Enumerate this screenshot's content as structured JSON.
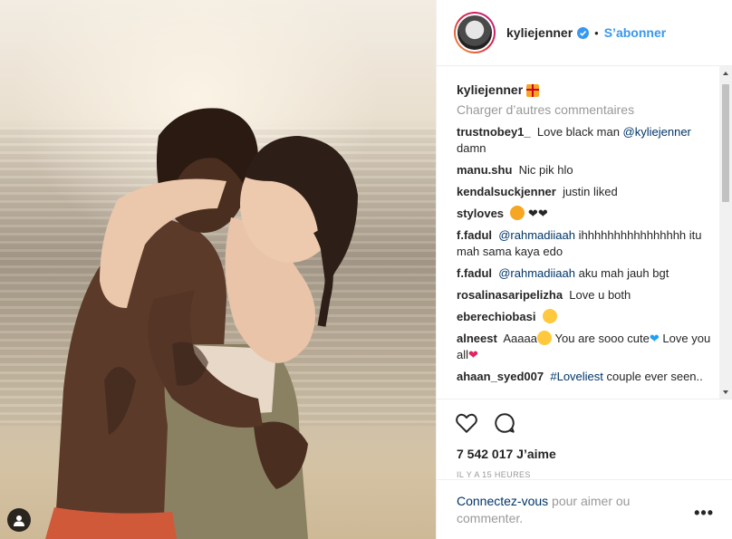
{
  "header": {
    "username": "kyliejenner",
    "dot": "•",
    "follow_label": "S’abonner"
  },
  "caption": {
    "username": "kyliejenner",
    "emoji": "gift-emoji"
  },
  "load_more_label": "Charger d’autres commentaires",
  "comments": [
    {
      "user": "trustnobey1_",
      "pre": "Love black man ",
      "mention": "@kyliejenner",
      "post": " damn"
    },
    {
      "user": "manu.shu",
      "pre": "Nic pik hlo",
      "mention": "",
      "post": ""
    },
    {
      "user": "kendalsuckjenner",
      "pre": "justin liked",
      "mention": "",
      "post": ""
    },
    {
      "user": "styloves",
      "pre": "",
      "mention": "",
      "post": ""
    },
    {
      "user": "f.fadul",
      "pre": "",
      "mention": "@rahmadiiaah",
      "post": " ihhhhhhhhhhhhhhhh itu mah sama kaya edo"
    },
    {
      "user": "f.fadul",
      "pre": "",
      "mention": "@rahmadiiaah",
      "post": " aku mah jauh bgt"
    },
    {
      "user": "rosalinasaripelizha",
      "pre": "Love u both",
      "mention": "",
      "post": ""
    },
    {
      "user": "eberechiobasi",
      "pre": "",
      "mention": "",
      "post": ""
    },
    {
      "user": "alneest",
      "pre": "Aaaaa",
      "mention": "",
      "post": "You are sooo cute",
      "post2": "Love you all"
    },
    {
      "user": "ahaan_syed007",
      "pre": "",
      "mention": "#Loveliest",
      "post": " couple ever seen.."
    }
  ],
  "likes": "7 542 017 J’aime",
  "time": "IL Y A 15 HEURES",
  "login": {
    "link": "Connectez-vous",
    "rest": " pour aimer ou commenter."
  },
  "more_label": "•••",
  "icons": [
    "verified-badge-icon",
    "heart-icon",
    "comment-icon",
    "user-tag-icon",
    "more-options-icon"
  ],
  "colors": {
    "accent": "#3897f0",
    "link": "#003569",
    "muted": "#999999"
  }
}
